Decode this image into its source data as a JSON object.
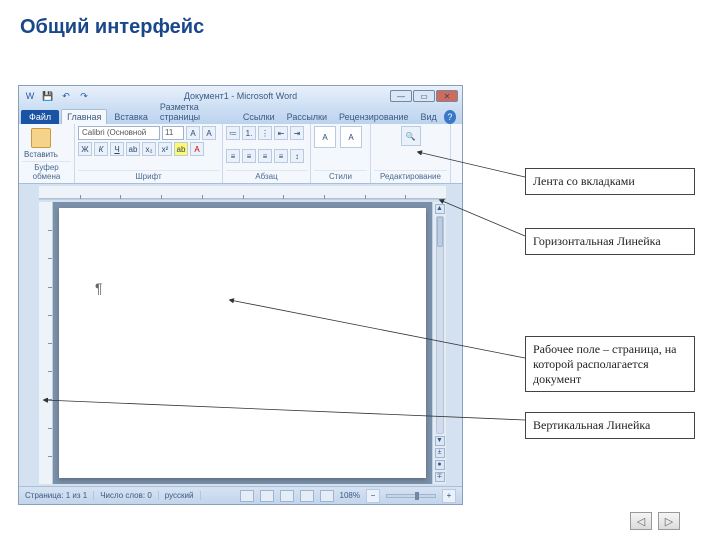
{
  "slide": {
    "title": "Общий интерфейс"
  },
  "titlebar": {
    "doc": "Документ1 - Microsoft Word"
  },
  "tabs": {
    "file": "Файл",
    "items": [
      "Главная",
      "Вставка",
      "Разметка страницы",
      "Ссылки",
      "Рассылки",
      "Рецензирование",
      "Вид"
    ],
    "active_index": 0
  },
  "ribbon": {
    "clipboard": {
      "paste": "Вставить",
      "group": "Буфер обмена"
    },
    "font": {
      "name": "Calibri (Основной те",
      "size": "11",
      "bold": "Ж",
      "italic": "К",
      "underline": "Ч",
      "group": "Шрифт"
    },
    "paragraph": {
      "group": "Абзац"
    },
    "styles": {
      "group": "Стили"
    },
    "editing": {
      "group": "Редактирование"
    }
  },
  "status": {
    "page": "Страница: 1 из 1",
    "words": "Число слов: 0",
    "lang": "русский",
    "zoom": "108%"
  },
  "callouts": {
    "ribbon": "Лента со вкладками",
    "ruler_h": "Горизонтальная Линейка",
    "workarea": "Рабочее поле – страница, на которой располагается документ",
    "ruler_v": "Вертикальная Линейка"
  },
  "glyphs": {
    "pilcrow": "¶",
    "help": "?",
    "prev": "◁",
    "next": "▷"
  }
}
